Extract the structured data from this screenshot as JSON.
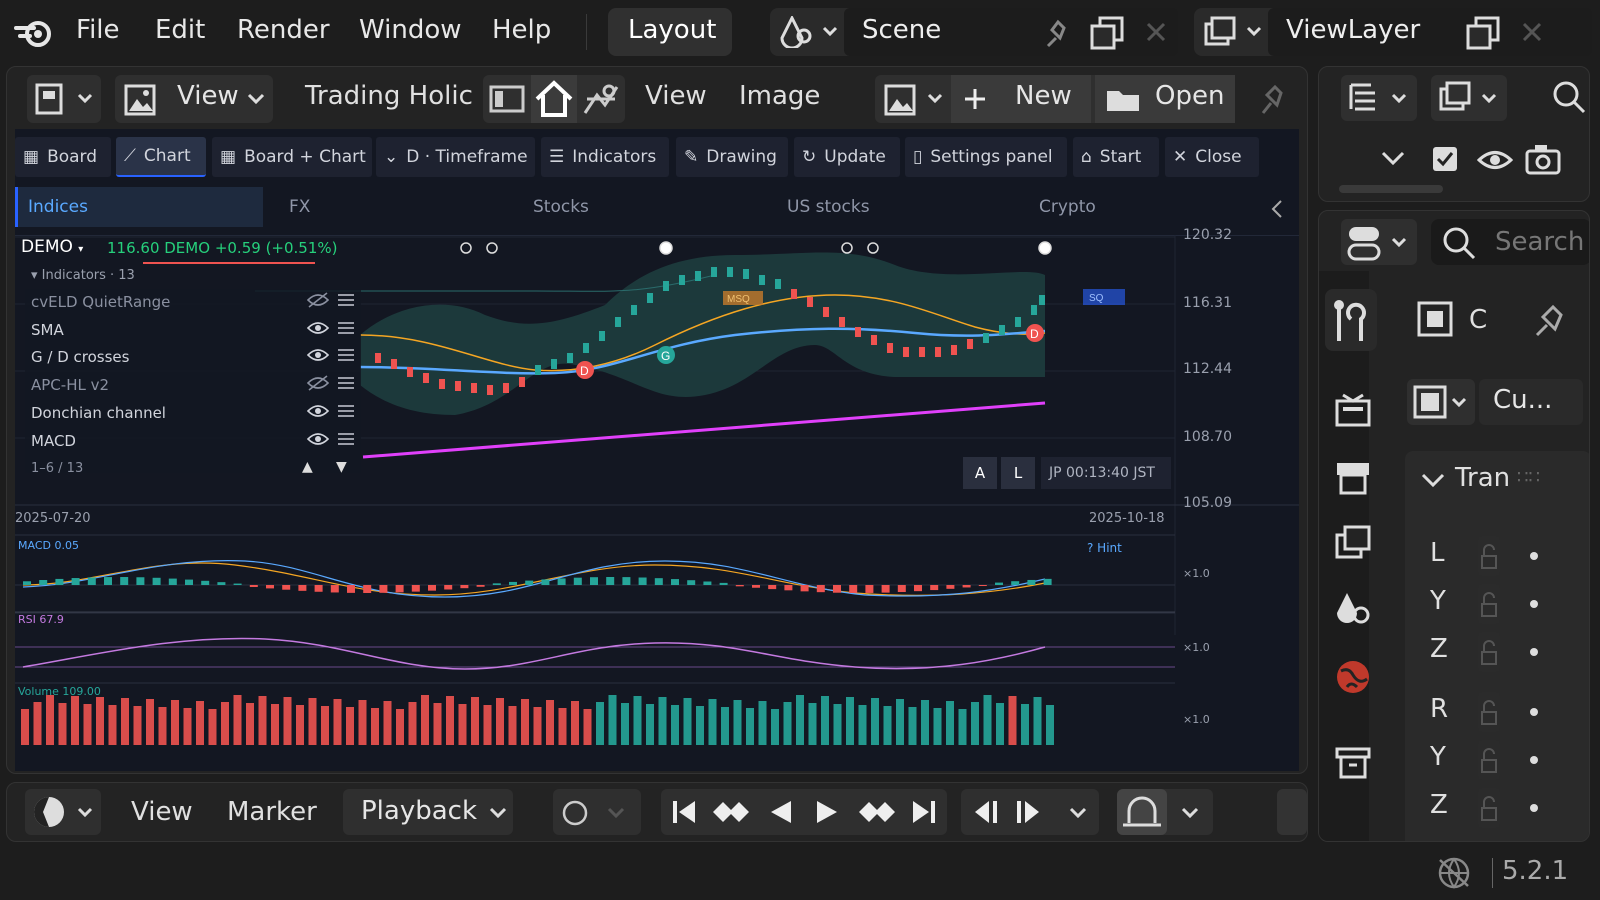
{
  "menu": {
    "file": "File",
    "edit": "Edit",
    "render": "Render",
    "window": "Window",
    "help": "Help"
  },
  "workspace_tab": "Layout",
  "scene": {
    "name": "Scene"
  },
  "view_layer": {
    "name": "ViewLayer"
  },
  "editor_header": {
    "view": "View",
    "app_name": "Trading Holic",
    "view2": "View",
    "image": "Image",
    "new": "New",
    "open": "Open"
  },
  "toolbar": {
    "board": "Board",
    "chart": "Chart",
    "board_chart": "Board + Chart",
    "timeframe": "D · Timeframe",
    "indicators": "Indicators",
    "drawing": "Drawing",
    "update": "Update",
    "settings": "Settings panel",
    "start": "Start",
    "close": "Close"
  },
  "categories": [
    "Indices",
    "FX",
    "Stocks",
    "US stocks",
    "Crypto"
  ],
  "symbol": {
    "name": "DEMO",
    "quote": "116.60 DEMO",
    "change": "+0.59",
    "change_pct": "(+0.51%)"
  },
  "indicators_panel": {
    "header": "Indicators · 13",
    "items": [
      {
        "name": "cvELD QuietRange",
        "visible": false
      },
      {
        "name": "SMA",
        "visible": true
      },
      {
        "name": "G / D crosses",
        "visible": true
      },
      {
        "name": "APC-HL v2",
        "visible": false
      },
      {
        "name": "Donchian channel",
        "visible": true
      },
      {
        "name": "MACD",
        "visible": true
      }
    ],
    "pager": "1–6 / 13"
  },
  "price_axis": [
    "120.32",
    "116.31",
    "112.44",
    "108.70",
    "105.09"
  ],
  "chart_buttons": {
    "a": "A",
    "l": "L",
    "clock": "JP 00:13:40 JST"
  },
  "markers": {
    "msq": "MSQ",
    "sq": "SQ",
    "g": "G",
    "d": "D"
  },
  "date_range": {
    "start": "2025-07-20",
    "end": "2025-10-18"
  },
  "subpanes": {
    "macd": "MACD 0.05",
    "rsi": "RSI 67.9",
    "volume": "Volume 109.00",
    "hint": "? Hint",
    "scale": "×1.0"
  },
  "timeline": {
    "view": "View",
    "marker": "Marker",
    "playback": "Playback"
  },
  "properties": {
    "c_label": "C",
    "camera": "Cu...",
    "search_placeholder": "Search",
    "transform": "Tran"
  },
  "transform_axes": [
    "L",
    "Y",
    "Z",
    "R",
    "Y",
    "Z"
  ],
  "version": "5.2.1",
  "chart_data": {
    "type": "line",
    "title": "",
    "symbol": "DEMO",
    "x": [
      "2025-07-20",
      "2025-10-18"
    ],
    "ylim": [
      105.09,
      120.32
    ],
    "y_ticks": [
      120.32,
      116.31,
      112.44,
      108.7,
      105.09
    ],
    "last_price": 116.6,
    "series": []
  },
  "colors": {
    "bg": "#131722",
    "up": "#26a69a",
    "down": "#ef5350",
    "accent": "#2962ff",
    "sma": "#5aa9ff",
    "signal": "#f5a623",
    "trend": "#e040fb"
  }
}
